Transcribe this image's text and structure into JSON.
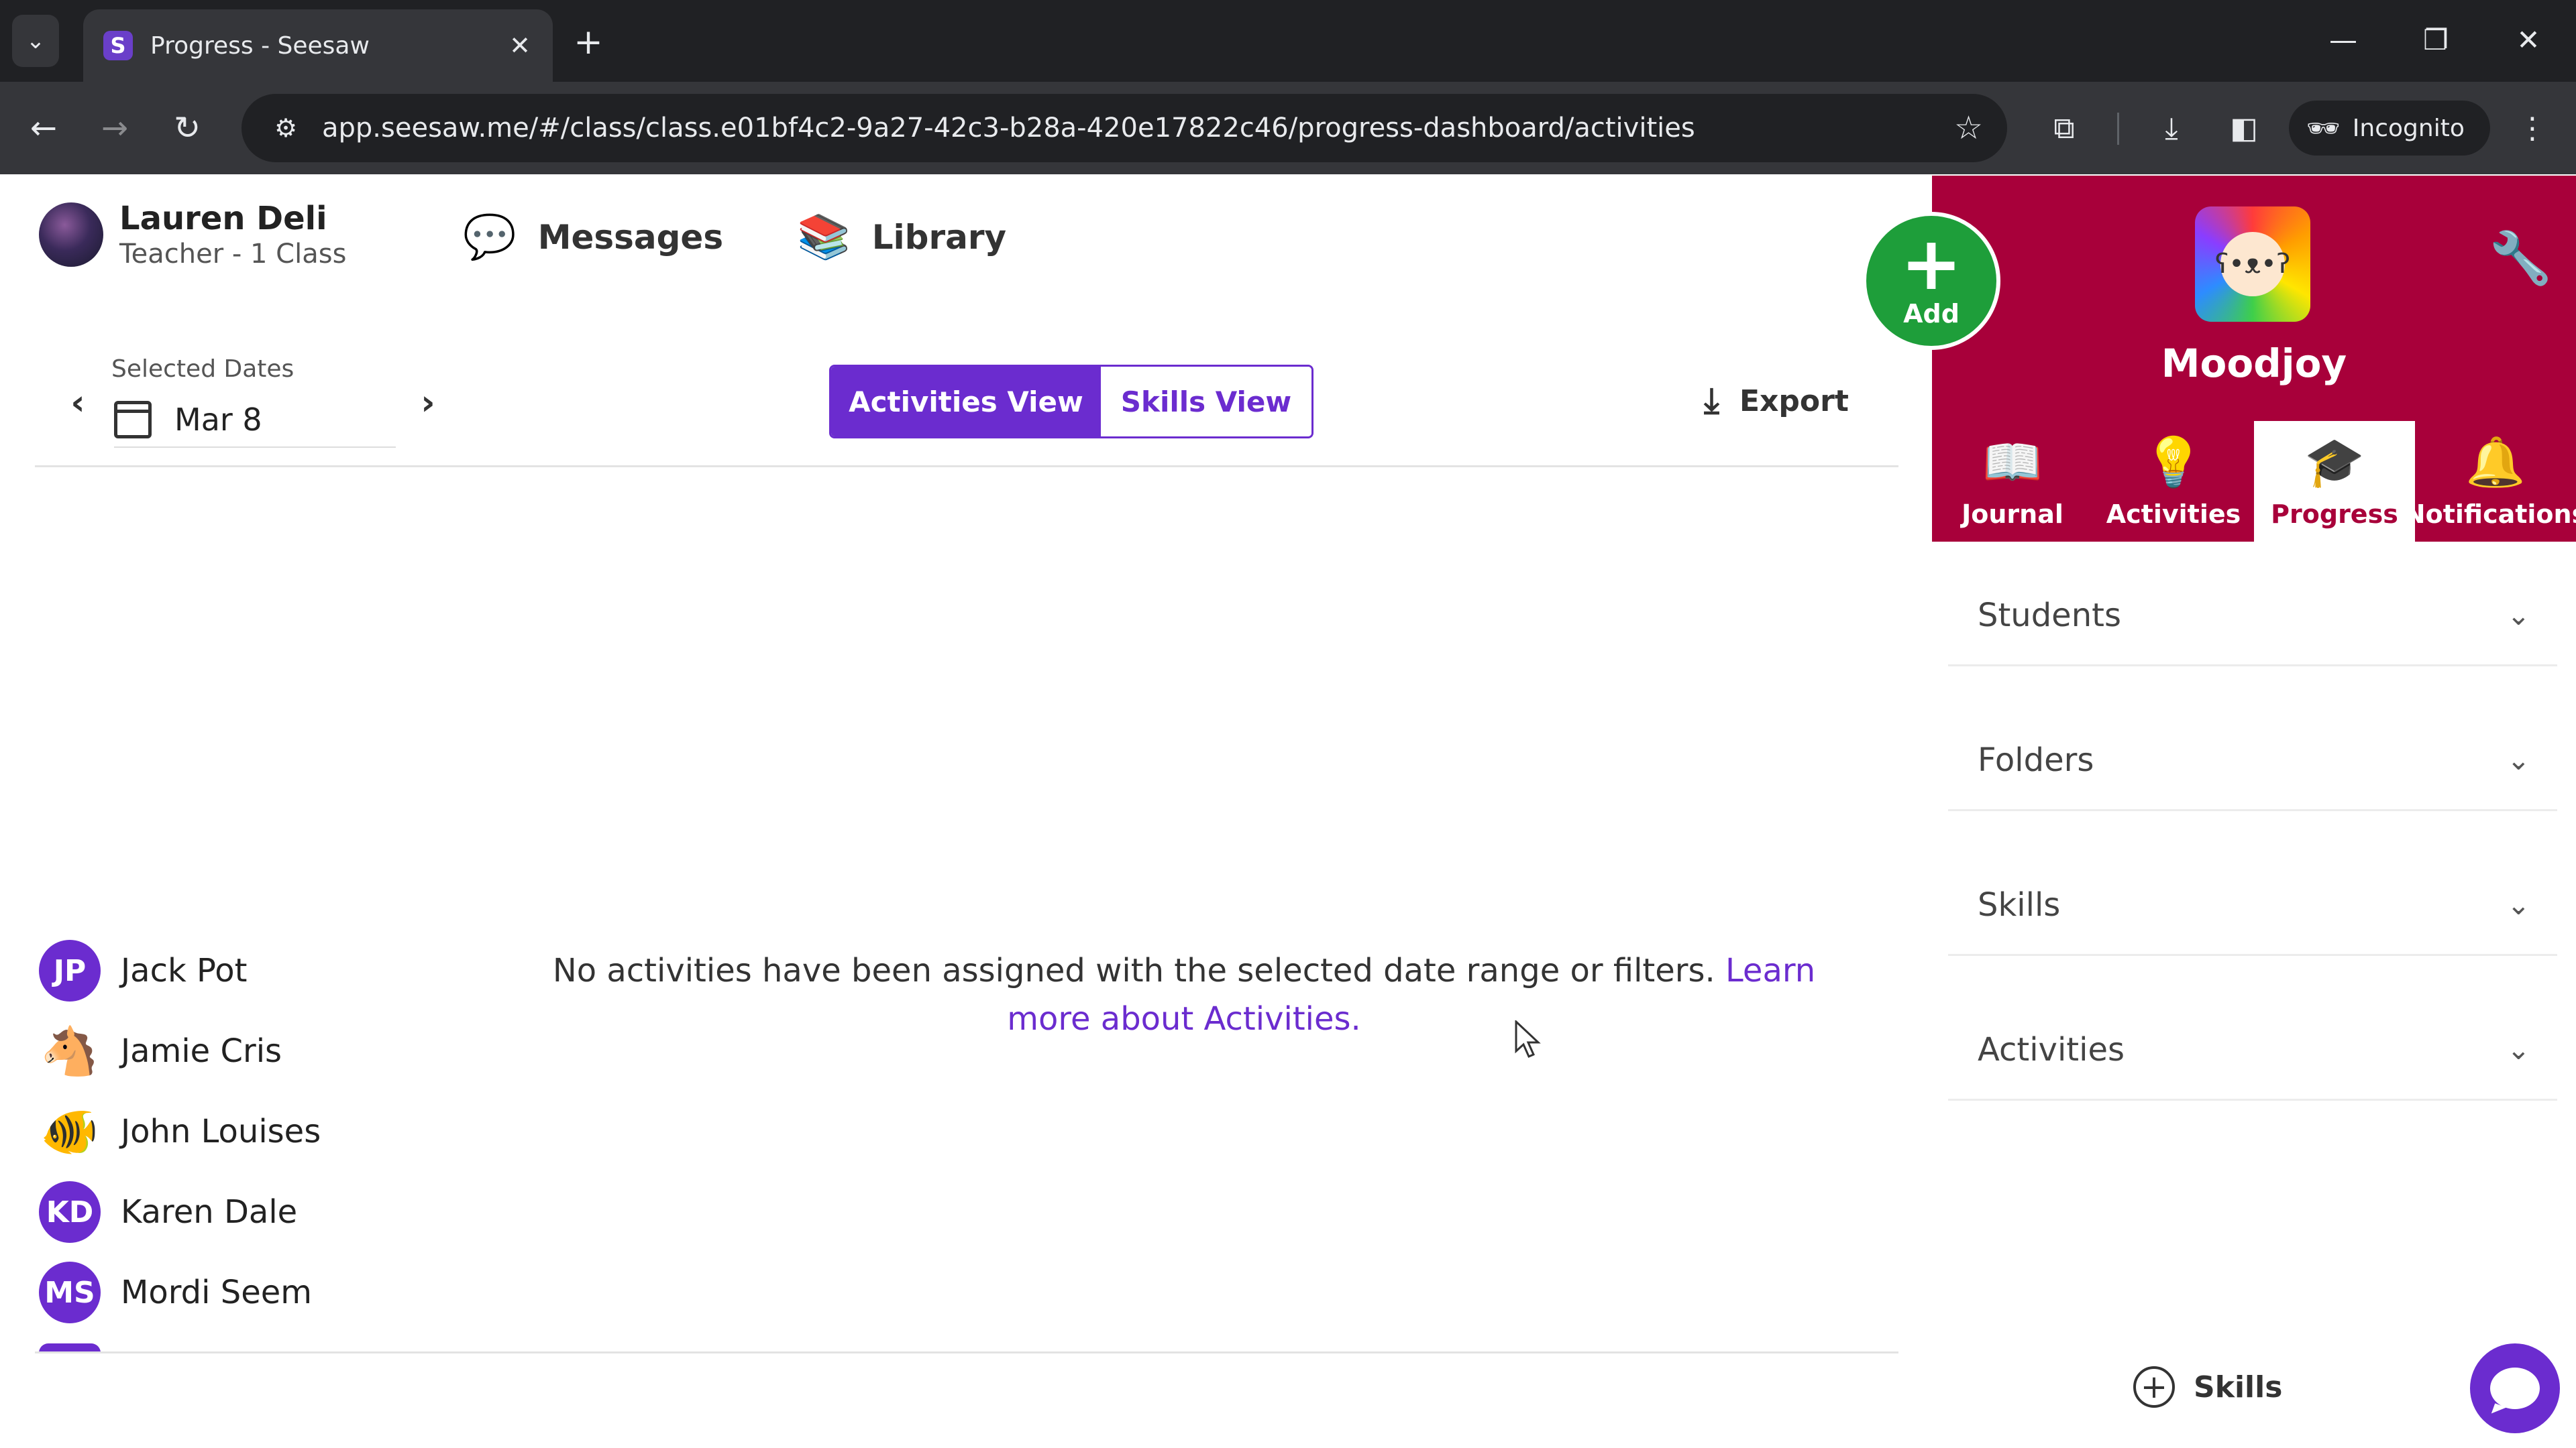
{
  "browser": {
    "tab_title": "Progress - Seesaw",
    "favicon_letter": "S",
    "url": "app.seesaw.me/#/class/class.e01bf4c2-9a27-42c3-b28a-420e17822c46/progress-dashboard/activities",
    "incognito_label": "Incognito"
  },
  "header": {
    "user_name": "Lauren Deli",
    "user_role": "Teacher - 1 Class",
    "messages_label": "Messages",
    "library_label": "Library"
  },
  "dates": {
    "label": "Selected Dates",
    "value": "Mar 8"
  },
  "views": {
    "activities_label": "Activities View",
    "skills_label": "Skills View",
    "active": "Activities View"
  },
  "export_label": "Export",
  "students": [
    {
      "name": "Jack Pot",
      "initials": "JP",
      "avatar": "initials"
    },
    {
      "name": "Jamie Cris",
      "initials": "",
      "avatar": "horse-icon"
    },
    {
      "name": "John Louises",
      "initials": "",
      "avatar": "fish-icon"
    },
    {
      "name": "Karen Dale",
      "initials": "KD",
      "avatar": "initials"
    },
    {
      "name": "Mordi Seem",
      "initials": "MS",
      "avatar": "initials"
    }
  ],
  "empty_state": {
    "message": "No activities have been assigned with the selected date range or filters.",
    "link_text": "Learn more about Activities."
  },
  "class_panel": {
    "add_label": "Add",
    "class_name": "Moodjoy",
    "brand_color": "#a8003a",
    "accent_color": "#6b2ccf",
    "add_color": "#1e9e3a",
    "nav": [
      {
        "label": "Journal",
        "icon": "book-icon"
      },
      {
        "label": "Activities",
        "icon": "lightbulb-icon"
      },
      {
        "label": "Progress",
        "icon": "graduation-cap-icon"
      },
      {
        "label": "Notifications",
        "icon": "bell-icon"
      }
    ],
    "active_nav": "Progress",
    "filters": [
      {
        "label": "Students"
      },
      {
        "label": "Folders"
      },
      {
        "label": "Skills"
      },
      {
        "label": "Activities"
      }
    ],
    "skills_button_label": "Skills"
  }
}
